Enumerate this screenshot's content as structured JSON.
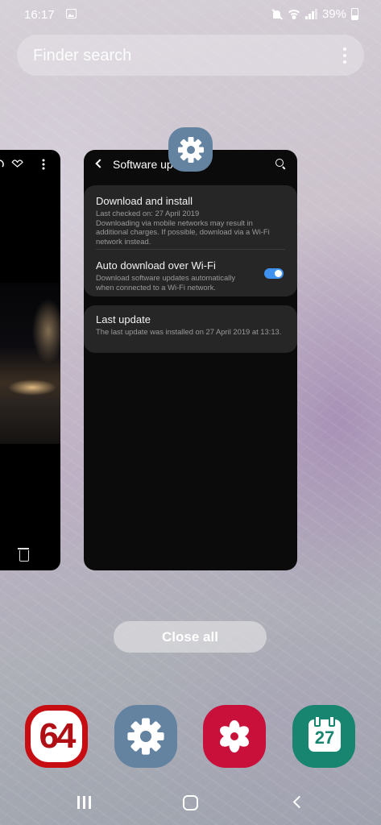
{
  "status_bar": {
    "time": "16:17",
    "battery": "39%",
    "icons": [
      "gallery-icon",
      "mute-icon",
      "wifi-icon",
      "signal-icon",
      "battery-icon"
    ]
  },
  "search": {
    "placeholder": "Finder search"
  },
  "recent_apps": {
    "left_card": {
      "app": "Gallery"
    },
    "main_card": {
      "title": "Software update",
      "items": [
        {
          "title": "Download and install",
          "description": "Last checked on: 27 April 2019\nDownloading via mobile networks may result in additional charges. If possible, download via a Wi-Fi network instead."
        },
        {
          "title": "Auto download over Wi-Fi",
          "description": "Download software updates automatically when connected to a Wi-Fi network.",
          "toggle_on": true
        },
        {
          "title": "Last update",
          "description": "The last update was installed on 27 April 2019 at 13:13."
        }
      ]
    }
  },
  "close_all_label": "Close all",
  "dock": {
    "apps": [
      {
        "name": "AIDA64",
        "label": "64"
      },
      {
        "name": "Settings"
      },
      {
        "name": "Galaxy Store"
      },
      {
        "name": "Calendar",
        "label": "27"
      }
    ]
  },
  "colors": {
    "toggle_on": "#3e91ee",
    "settings_icon": "#6483a1",
    "aida_red": "#c70d12",
    "store_red": "#c8103b",
    "calendar_green": "#17856f"
  }
}
